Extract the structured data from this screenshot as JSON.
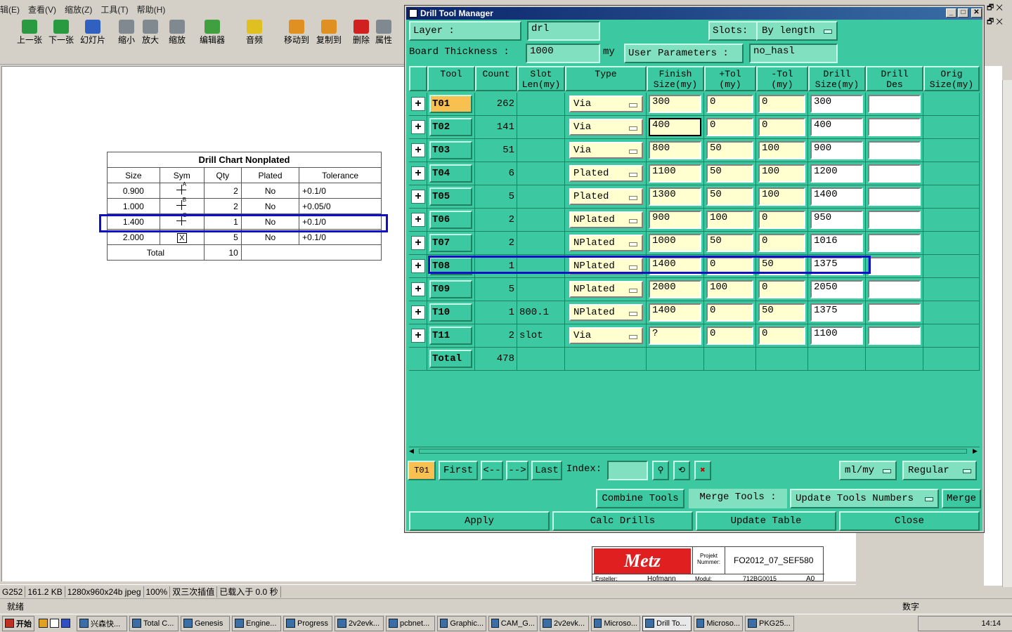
{
  "viewer": {
    "menu": [
      "辑(E)",
      "查看(V)",
      "缩放(Z)",
      "工具(T)",
      "帮助(H)"
    ],
    "toolbar": [
      {
        "label": "上一张",
        "icon": "prev-image-icon"
      },
      {
        "label": "下一张",
        "icon": "next-image-icon"
      },
      {
        "label": "幻灯片",
        "icon": "slideshow-icon"
      },
      {
        "label": "缩小",
        "icon": "zoom-out-icon"
      },
      {
        "label": "放大",
        "icon": "zoom-in-icon"
      },
      {
        "label": "缩放",
        "icon": "zoom-icon"
      },
      {
        "label": "编辑器",
        "icon": "editor-icon"
      },
      {
        "label": "音频",
        "icon": "audio-icon"
      },
      {
        "label": "移动到",
        "icon": "move-to-icon"
      },
      {
        "label": "复制到",
        "icon": "copy-to-icon"
      },
      {
        "label": "删除",
        "icon": "delete-icon"
      },
      {
        "label": "属性",
        "icon": "properties-icon"
      }
    ],
    "drill_chart": {
      "title": "Drill Chart Nonplated",
      "headers": [
        "Size",
        "Sym",
        "Qty",
        "Plated",
        "Tolerance"
      ],
      "rows": [
        {
          "size": "0.900",
          "sym": "A",
          "qty": "2",
          "plated": "No",
          "tol": "+0.1/0"
        },
        {
          "size": "1.000",
          "sym": "B",
          "qty": "2",
          "plated": "No",
          "tol": "+0.05/0"
        },
        {
          "size": "1.400",
          "sym": "C",
          "qty": "1",
          "plated": "No",
          "tol": "+0.1/0"
        },
        {
          "size": "2.000",
          "sym": "X",
          "qty": "5",
          "plated": "No",
          "tol": "+0.1/0"
        }
      ],
      "total_label": "Total",
      "total_qty": "10"
    },
    "title_block": {
      "logo": "Metz",
      "projekt_label": "Projekt Nummer:",
      "projekt_value": "FO2012_07_SEF580",
      "ersteller_label": "Ersteller:",
      "ersteller_value": "Hofmann",
      "modul_label": "Modul:",
      "modul_value": "712BG0015",
      "sheet": "A0"
    },
    "status": [
      "G252",
      "161.2 KB",
      "1280x960x24b jpeg",
      "100%",
      "双三次插值",
      "已载入于 0.0 秒"
    ],
    "status2_left": "就绪",
    "status2_right": "数字"
  },
  "dtm": {
    "title": "Drill Tool Manager",
    "layer_label": "Layer          :",
    "layer_value": "drl",
    "slots_label": "Slots:",
    "slots_value": "By length",
    "thickness_label": "Board Thickness :",
    "thickness_value": "1000",
    "thickness_unit": "my",
    "user_params_label": "User Parameters :",
    "user_params_value": "no_hasl",
    "columns": [
      "Tool",
      "Count",
      "Slot\nLen(my)",
      "Type",
      "Finish\nSize(my)",
      "+Tol\n(my)",
      "-Tol\n(my)",
      "Drill\nSize(my)",
      "Drill\nDes",
      "Orig\nSize(my)"
    ],
    "rows": [
      {
        "tool": "T01",
        "count": "262",
        "slot": "",
        "type": "Via",
        "finish": "300",
        "ptol": "0",
        "mtol": "0",
        "drill": "300"
      },
      {
        "tool": "T02",
        "count": "141",
        "slot": "",
        "type": "Via",
        "finish": "400",
        "ptol": "0",
        "mtol": "0",
        "drill": "400"
      },
      {
        "tool": "T03",
        "count": "51",
        "slot": "",
        "type": "Via",
        "finish": "800",
        "ptol": "50",
        "mtol": "100",
        "drill": "900"
      },
      {
        "tool": "T04",
        "count": "6",
        "slot": "",
        "type": "Plated",
        "finish": "1100",
        "ptol": "50",
        "mtol": "100",
        "drill": "1200"
      },
      {
        "tool": "T05",
        "count": "5",
        "slot": "",
        "type": "Plated",
        "finish": "1300",
        "ptol": "50",
        "mtol": "100",
        "drill": "1400"
      },
      {
        "tool": "T06",
        "count": "2",
        "slot": "",
        "type": "NPlated",
        "finish": "900",
        "ptol": "100",
        "mtol": "0",
        "drill": "950"
      },
      {
        "tool": "T07",
        "count": "2",
        "slot": "",
        "type": "NPlated",
        "finish": "1000",
        "ptol": "50",
        "mtol": "0",
        "drill": "1016"
      },
      {
        "tool": "T08",
        "count": "1",
        "slot": "",
        "type": "NPlated",
        "finish": "1400",
        "ptol": "0",
        "mtol": "50",
        "drill": "1375"
      },
      {
        "tool": "T09",
        "count": "5",
        "slot": "",
        "type": "NPlated",
        "finish": "2000",
        "ptol": "100",
        "mtol": "0",
        "drill": "2050"
      },
      {
        "tool": "T10",
        "count": "1",
        "slot": "800.1",
        "type": "NPlated",
        "finish": "1400",
        "ptol": "0",
        "mtol": "50",
        "drill": "1375"
      },
      {
        "tool": "T11",
        "count": "2",
        "slot": "slot",
        "type": "Via",
        "finish": "?",
        "ptol": "0",
        "mtol": "0",
        "drill": "1100"
      }
    ],
    "total_label": "Total",
    "total_count": "478",
    "nav": {
      "current": "T01",
      "first": "First",
      "prev": "<--",
      "next": "-->",
      "last": "Last",
      "index_label": "Index:",
      "units": "ml/my",
      "mode": "Regular"
    },
    "combine": "Combine Tools",
    "merge_label": "Merge Tools :",
    "merge_select": "Update Tools Numbers",
    "merge": "Merge",
    "apply": "Apply",
    "calc": "Calc Drills",
    "update": "Update Table",
    "close": "Close"
  },
  "taskbar": {
    "start": "开始",
    "items": [
      "兴森快...",
      "Total C...",
      "Genesis",
      "Engine...",
      "Progress",
      "2v2evk...",
      "pcbnet...",
      "Graphic...",
      "CAM_G...",
      "2v2evk...",
      "Microso...",
      "Drill To...",
      "Microso...",
      "PKG25..."
    ],
    "time": "14:14"
  }
}
